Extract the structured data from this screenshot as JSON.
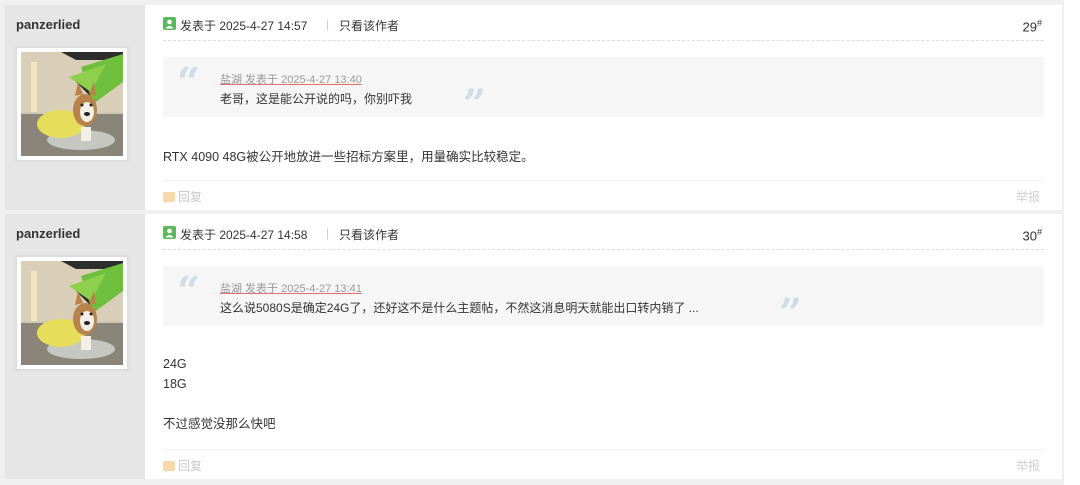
{
  "posts": [
    {
      "author": "panzerlied",
      "online_icon": "online-status-icon",
      "time": "发表于 2025-4-27 14:57",
      "separator": "|",
      "only_author": "只看该作者",
      "floor": "29",
      "floor_mark": "#",
      "quote": {
        "meta": "盐湖 发表于 2025-4-27 13:40",
        "text": "老哥，这是能公开说的吗，你别吓我"
      },
      "lines": [
        "RTX 4090 48G被公开地放进一些招标方案里，用量确实比较稳定。"
      ],
      "reply": "回复",
      "report": "举报"
    },
    {
      "author": "panzerlied",
      "online_icon": "online-status-icon",
      "time": "发表于 2025-4-27 14:58",
      "separator": "|",
      "only_author": "只看该作者",
      "floor": "30",
      "floor_mark": "#",
      "quote": {
        "meta": "盐湖 发表于 2025-4-27 13:41",
        "text": "这么说5080S是确定24G了，还好这不是什么主题帖，不然这消息明天就能出口转内销了 ..."
      },
      "lines": [
        "24G",
        "18G",
        "",
        "不过感觉没那么快吧"
      ],
      "reply": "回复",
      "report": "举报"
    }
  ]
}
